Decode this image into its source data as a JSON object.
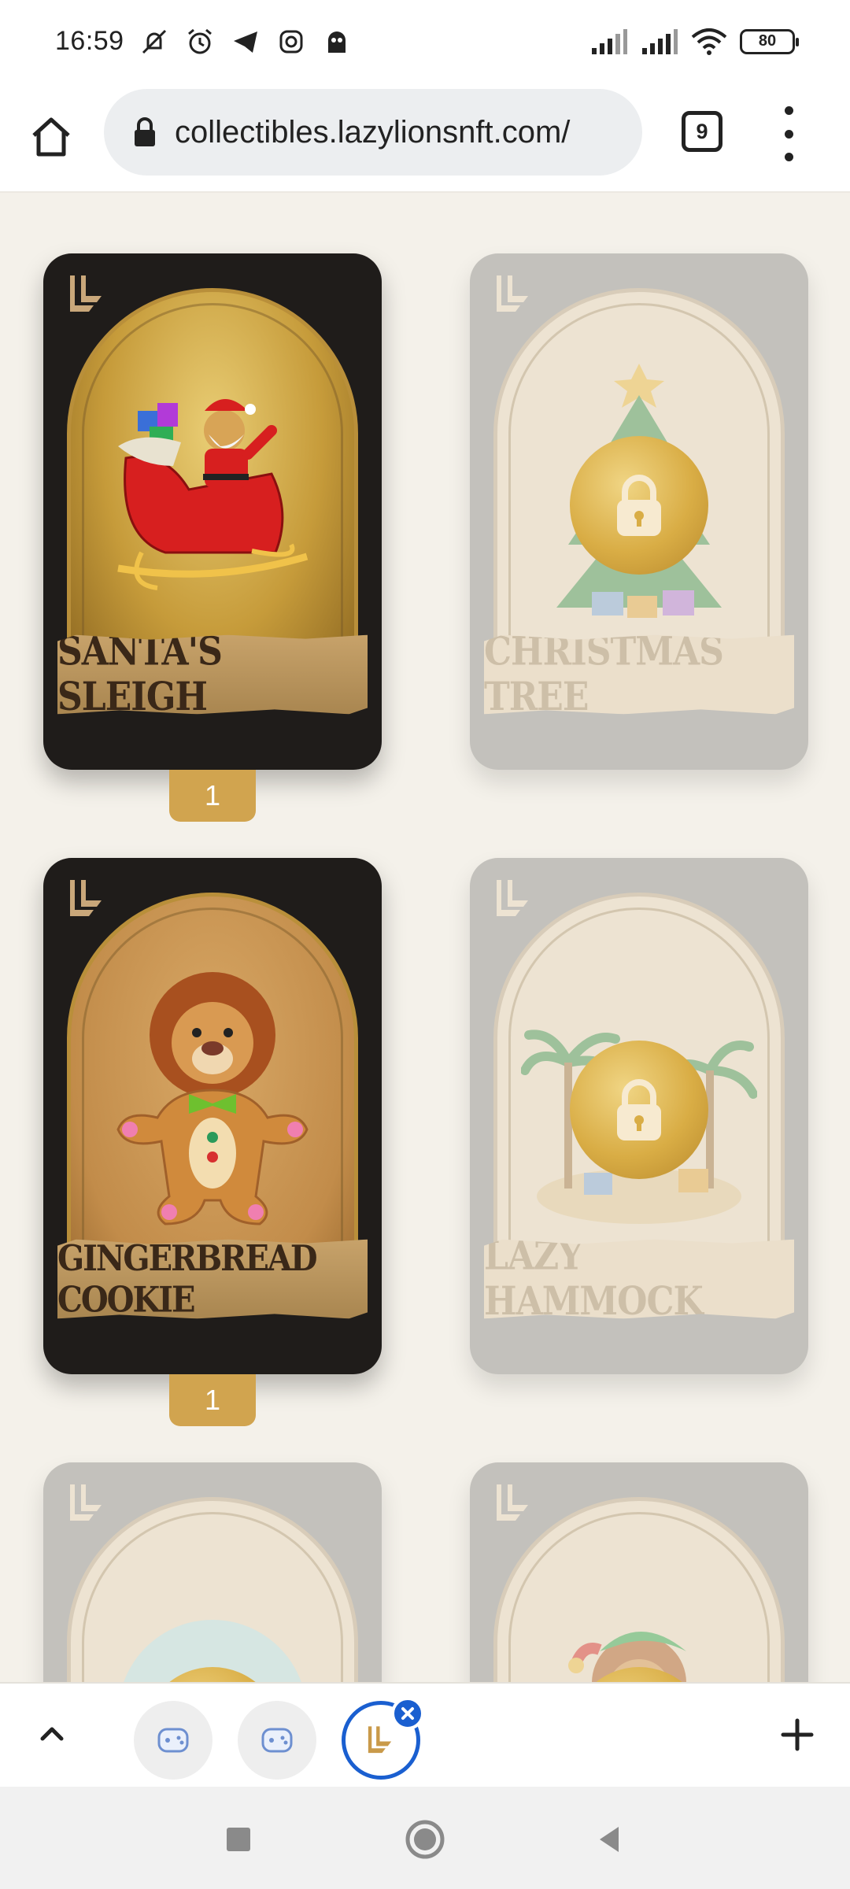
{
  "status_bar": {
    "time": "16:59",
    "battery": "80",
    "icons": [
      "mute-icon",
      "alarm-icon",
      "telegram-icon",
      "instagram-icon",
      "ghost-icon",
      "signal-icon",
      "signal-icon",
      "wifi-icon",
      "battery-icon"
    ]
  },
  "browser": {
    "url": "collectibles.lazylionsnft.com/",
    "tab_count": "9"
  },
  "cards": [
    {
      "title": "SANTA'S SLEIGH",
      "state": "unlocked",
      "count": "1",
      "art": "santa-sleigh"
    },
    {
      "title": "CHRISTMAS TREE",
      "state": "locked",
      "art": "christmas-tree"
    },
    {
      "title": "GINGERBREAD COOKIE",
      "state": "unlocked",
      "count": "1",
      "art": "gingerbread-lion"
    },
    {
      "title": "LAZY HAMMOCK",
      "state": "locked",
      "art": "lazy-hammock"
    },
    {
      "title": "",
      "state": "locked",
      "art": "snow-globe"
    },
    {
      "title": "",
      "state": "locked",
      "art": "elf-lion"
    }
  ],
  "colors": {
    "background": "#f4f1ea",
    "card_dark": "#1f1c1a",
    "card_locked": "#c3c1bc",
    "gold": "#d1a44f",
    "active_tab": "#1a5fd0"
  }
}
